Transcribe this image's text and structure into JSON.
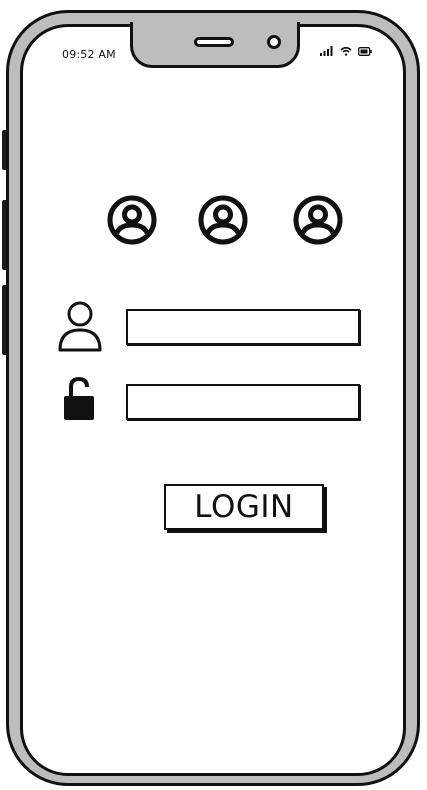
{
  "status_bar": {
    "time": "09:52 AM",
    "icons": [
      "signal-icon",
      "wifi-icon",
      "battery-icon"
    ]
  },
  "avatars": [
    "user-avatar-icon",
    "user-avatar-icon",
    "user-avatar-icon"
  ],
  "login_form": {
    "username_icon": "user-outline-icon",
    "username_value": "",
    "password_icon": "unlocked-padlock-icon",
    "password_value": "",
    "login_label": "LOGIN"
  },
  "colors": {
    "frame": "#bdbdbd",
    "outline": "#111111",
    "screen": "#ffffff"
  }
}
